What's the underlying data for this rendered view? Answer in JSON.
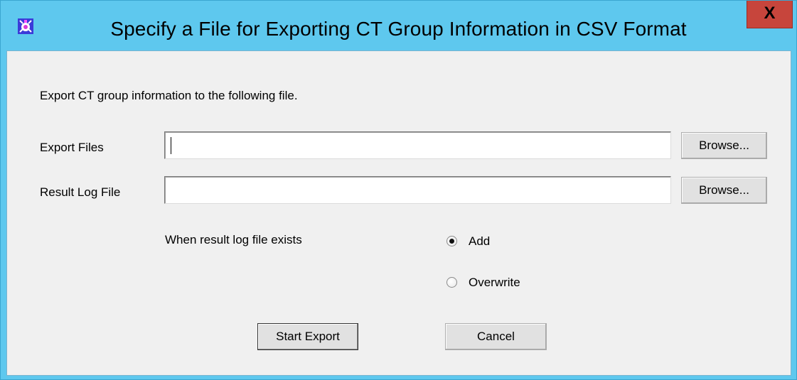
{
  "window": {
    "title": "Specify a File for Exporting CT Group Information in CSV Format",
    "close_label": "X"
  },
  "dialog": {
    "description": "Export CT group information to the following file.",
    "export_files": {
      "label": "Export Files",
      "value": "",
      "browse_label": "Browse..."
    },
    "result_log_file": {
      "label": "Result Log File",
      "value": "",
      "browse_label": "Browse..."
    },
    "when_exists": {
      "label": "When result log file exists",
      "options": [
        {
          "label": "Add",
          "checked": true
        },
        {
          "label": "Overwrite",
          "checked": false
        }
      ]
    },
    "start_export_label": "Start Export",
    "cancel_label": "Cancel"
  },
  "colors": {
    "titlebar": "#5ec8ee",
    "close_button": "#c7453c",
    "client_background": "#f0f0f0"
  },
  "icons": {
    "app": "app-icon"
  }
}
